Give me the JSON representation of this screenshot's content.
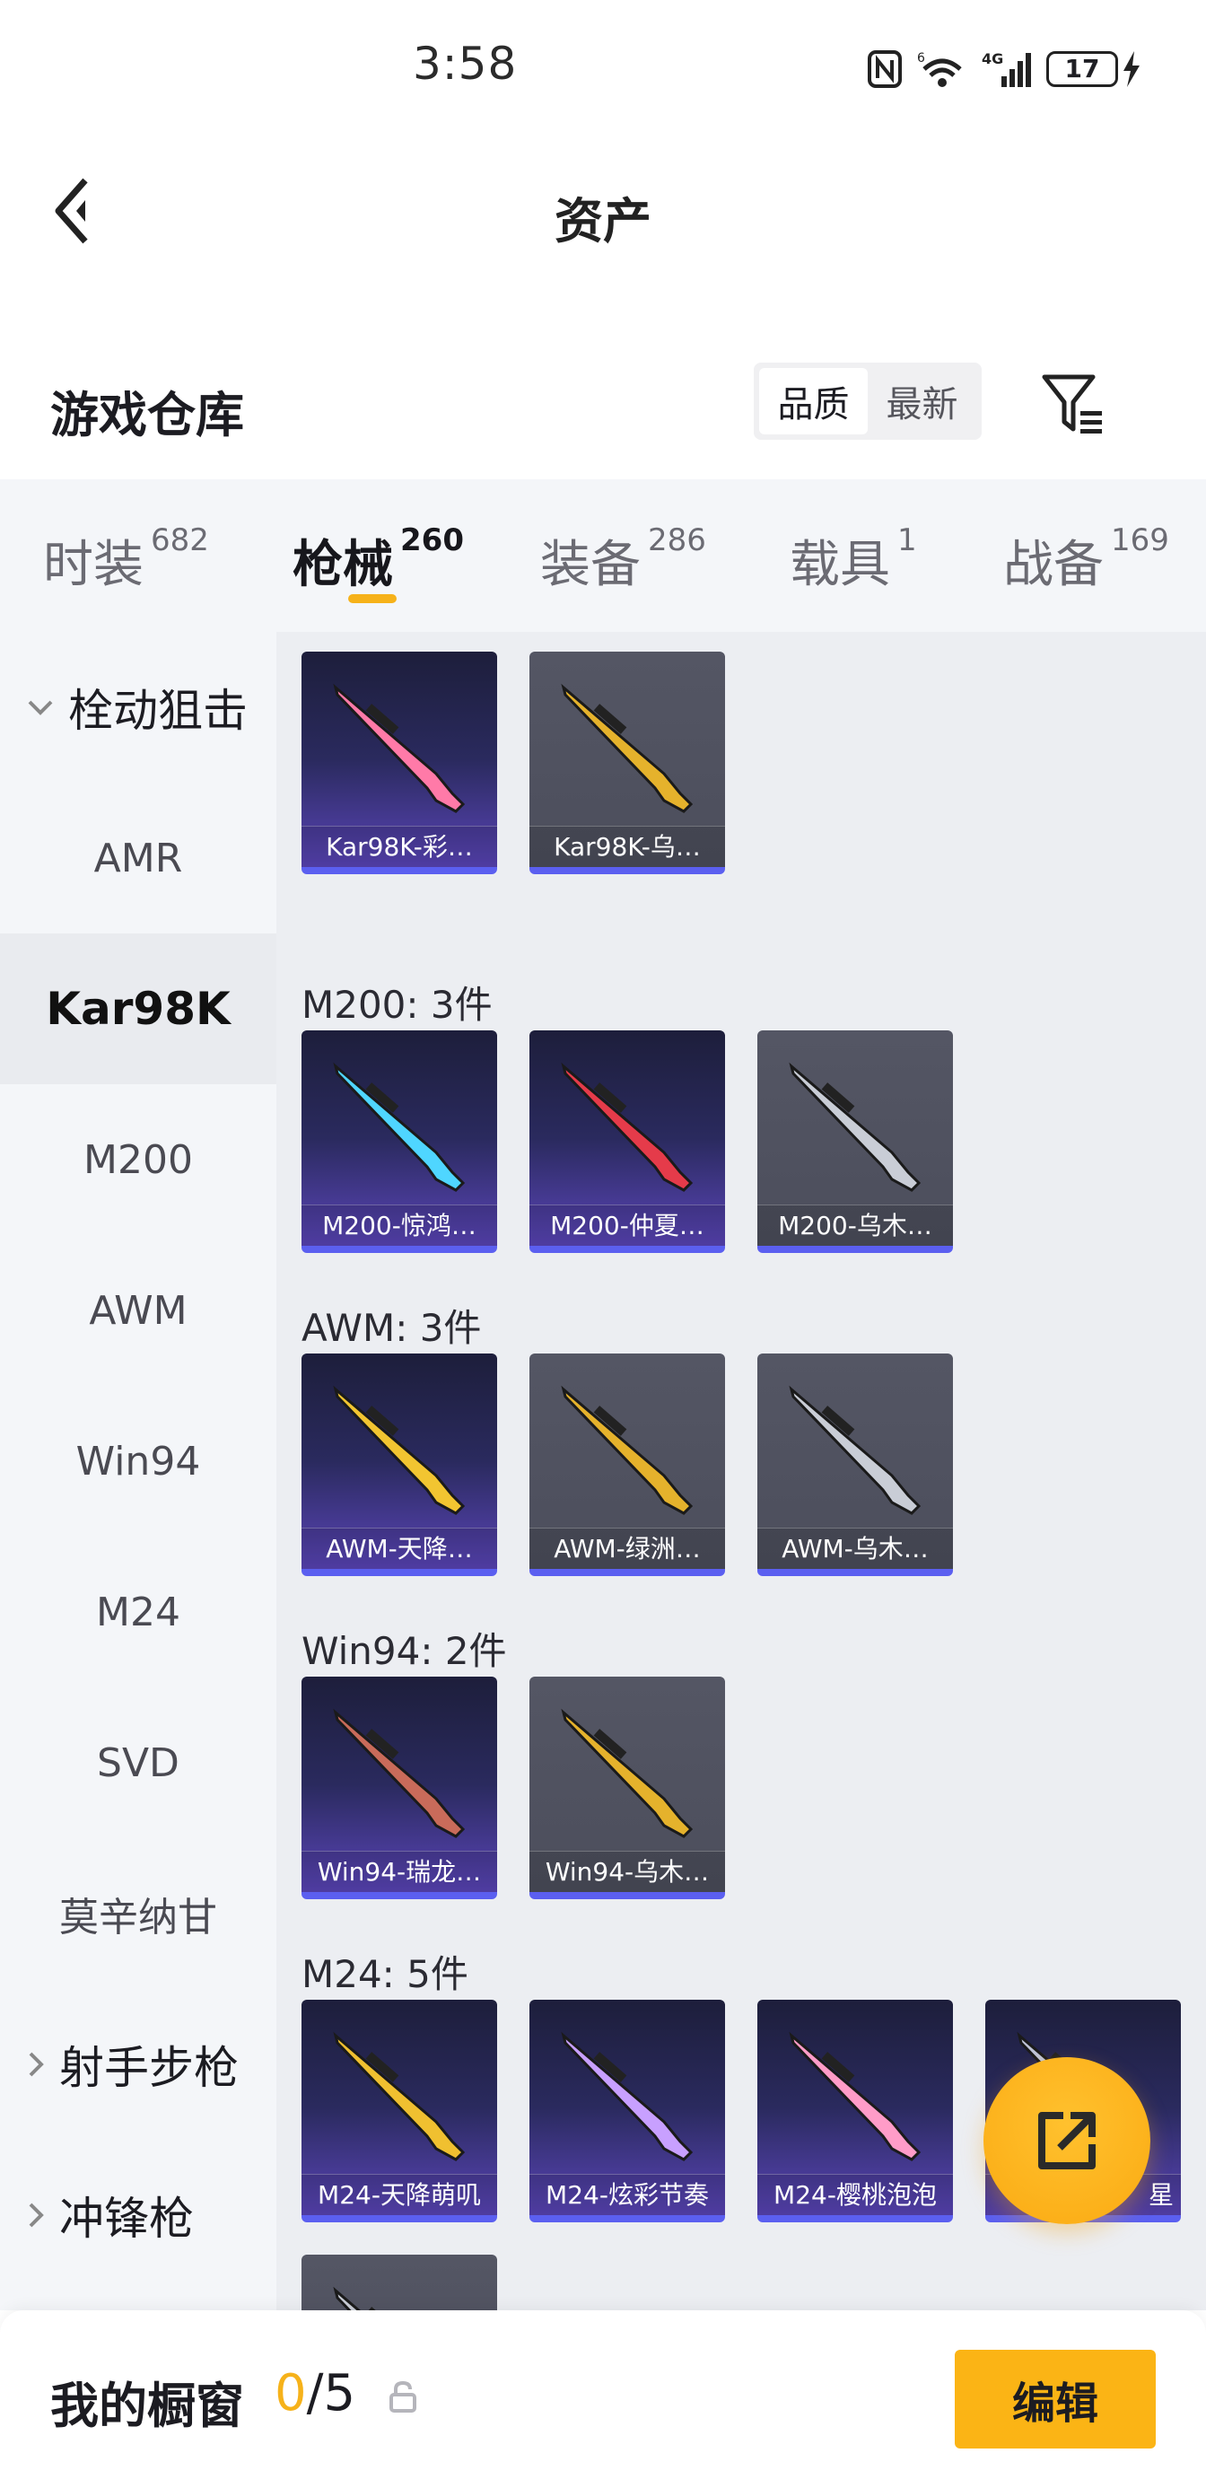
{
  "status_bar": {
    "time": "3:58",
    "network": "4G",
    "wifi_badge": "6",
    "battery_level": "17"
  },
  "header": {
    "title": "资产"
  },
  "warehouse": {
    "title": "游戏仓库",
    "sort_options": [
      "品质",
      "最新"
    ],
    "sort_selected": "品质"
  },
  "tabs": [
    {
      "label": "时装",
      "count": "682"
    },
    {
      "label": "枪械",
      "count": "260",
      "active": true
    },
    {
      "label": "装备",
      "count": "286"
    },
    {
      "label": "载具",
      "count": "1"
    },
    {
      "label": "战备",
      "count": "169"
    }
  ],
  "sidebar": {
    "group_bolt": "栓动狙击",
    "items": [
      "AMR",
      "Kar98K",
      "M200",
      "AWM",
      "Win94",
      "M24",
      "SVD",
      "莫辛纳甘"
    ],
    "selected": "Kar98K",
    "group_dmr": "射手步枪",
    "group_smg": "冲锋枪"
  },
  "sections": [
    {
      "label": "",
      "cards": [
        {
          "name": "Kar98K-彩…",
          "quality": "purple"
        },
        {
          "name": "Kar98K-乌…",
          "quality": "grey"
        }
      ]
    },
    {
      "label": "M200: 3件",
      "cards": [
        {
          "name": "M200-惊鸿…",
          "quality": "purple"
        },
        {
          "name": "M200-仲夏…",
          "quality": "purple"
        },
        {
          "name": "M200-乌木…",
          "quality": "grey"
        }
      ]
    },
    {
      "label": "AWM: 3件",
      "cards": [
        {
          "name": "AWM-天降…",
          "quality": "purple"
        },
        {
          "name": "AWM-绿洲…",
          "quality": "grey"
        },
        {
          "name": "AWM-乌木…",
          "quality": "grey"
        }
      ]
    },
    {
      "label": "Win94: 2件",
      "cards": [
        {
          "name": "Win94-瑞龙…",
          "quality": "purple"
        },
        {
          "name": "Win94-乌木…",
          "quality": "grey"
        }
      ]
    },
    {
      "label": "M24: 5件",
      "cards": [
        {
          "name": "M24-天降萌叽",
          "quality": "purple"
        },
        {
          "name": "M24-炫彩节奏",
          "quality": "purple"
        },
        {
          "name": "M24-樱桃泡泡",
          "quality": "purple"
        },
        {
          "name": "星",
          "quality": "purple"
        },
        {
          "name": "",
          "quality": "grey"
        }
      ]
    }
  ],
  "showcase": {
    "title": "我的橱窗",
    "used": "0",
    "total": "/5",
    "edit_label": "编辑"
  },
  "colors": {
    "accent": "#f6b21a",
    "card_border": "#5b5ff0",
    "purple_card": "#2a2a5e",
    "grey_card": "#4f515f"
  }
}
